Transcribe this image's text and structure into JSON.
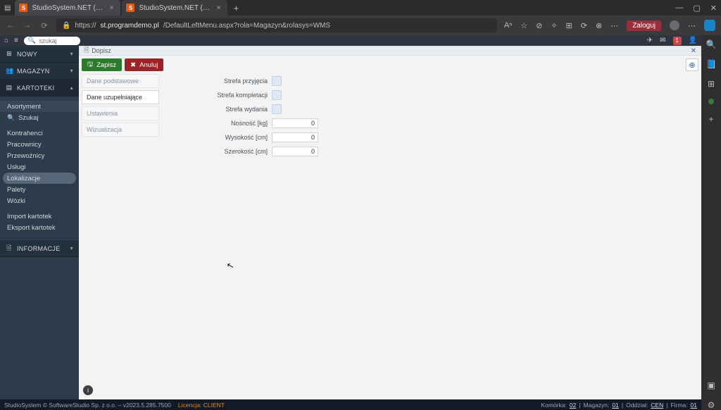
{
  "browser": {
    "tabs": [
      {
        "title": "StudioSystem.NET (c) SoftwareS..."
      },
      {
        "title": "StudioSystem.NET (c) SoftwareS..."
      }
    ],
    "add": "+",
    "win": {
      "min": "—",
      "max": "▢",
      "close": "✕"
    },
    "nav": {
      "back": "←",
      "fwd": "→",
      "reload": "⟳"
    },
    "lock": "🔒",
    "url_prefix": "https://",
    "url_host": "st.programdemo.pl",
    "url_path": "/DefaultLeftMenu.aspx?rola=Magazyn&rolasys=WMS",
    "icons": [
      "Aⁿ",
      "☆",
      "⊘",
      "✧",
      "⊞",
      "⟳",
      "⊗",
      "⋯"
    ],
    "login": "Zaloguj",
    "rail": [
      "🔍",
      "📘",
      "⊞",
      "💬"
    ],
    "rail_plus": "+",
    "rail_bottom": [
      "▣",
      "⚙"
    ]
  },
  "appbar": {
    "home": "⌂",
    "menu": "≡",
    "search_placeholder": "szukaj",
    "right_icons": [
      "✈",
      "✉"
    ]
  },
  "sidebar": {
    "sections": [
      {
        "icon": "⊞",
        "label": "NOWY"
      },
      {
        "icon": "👥",
        "label": "MAGAZYN"
      },
      {
        "icon": "▤",
        "label": "KARTOTEKI"
      },
      {
        "icon": "🗎",
        "label": "INFORMACJE"
      }
    ],
    "kartoteki_items": [
      "Asortyment",
      "Szukaj",
      "Kontrahenci",
      "Pracownicy",
      "Przewoźnicy",
      "Usługi",
      "Lokalizacje",
      "Palety",
      "Wózki",
      "Import kartotek",
      "Eksport kartotek"
    ],
    "search_icon": "🔍"
  },
  "content": {
    "header_icon": "🗎",
    "header_title": "Dopisz",
    "header_close": "✕",
    "save_label": "Zapisz",
    "save_icon": "🖫",
    "cancel_label": "Anuluj",
    "cancel_icon": "✖",
    "add_icon": "⊕",
    "vtabs": [
      "Dane podstawowe",
      "Dane uzupełniające",
      "Ustawienia",
      "Wizualizacja"
    ],
    "fields": {
      "strefa_przyjecia": "Strefa przyjęcia",
      "strefa_kompletacji": "Strefa kompletacji",
      "strefa_wydania": "Strefa wydania",
      "nosnosc": "Nośność [kg]",
      "wysokosc": "Wysokość [cm]",
      "szerokosc": "Szerokość [cm]",
      "val_nosnosc": "0",
      "val_wysokosc": "0",
      "val_szerokosc": "0"
    },
    "info_icon": "i"
  },
  "footer": {
    "left": "StudioSystem © SoftwareStudio Sp. z o.o. – v2023.5.285.7500",
    "licence": "Licencja: CLIENT",
    "right_parts": {
      "p1": "Komórka:",
      "v1": "02",
      "p2": "Magazyn:",
      "v2": "01",
      "p3": "Oddział:",
      "v3": "CEN",
      "p4": "Firma:",
      "v4": "01"
    }
  }
}
